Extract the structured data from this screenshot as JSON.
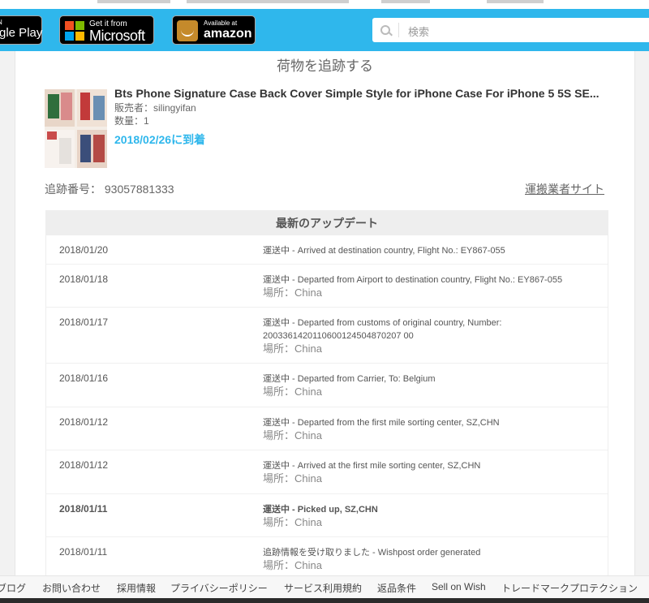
{
  "header": {
    "google_play": {
      "small": "N",
      "big": "gle Play"
    },
    "microsoft": {
      "small": "Get it from",
      "big": "Microsoft"
    },
    "amazon": {
      "small": "Available at",
      "big": "amazon",
      "brand_text": "amazon"
    },
    "search_placeholder": "検索"
  },
  "page": {
    "title": "荷物を追跡する",
    "product_name": "Bts Phone Signature Case Back Cover Simple Style for iPhone Case For iPhone 5 5S SE...",
    "seller": "販売者：silingyifan",
    "quantity": "数量：1",
    "arrival": "2018/02/26に到着",
    "tracking_number": "追跡番号： 93057881333",
    "carrier_site_link": "運搬業者サイト",
    "updates_title": "最新のアップデート"
  },
  "updates": [
    {
      "date": "2018/01/20",
      "status": "運送中 - Arrived at destination country, Flight No.: EY867-055",
      "location": ""
    },
    {
      "date": "2018/01/18",
      "status": "運送中 - Departed from Airport to destination country, Flight No.: EY867-055",
      "location": "場所：China"
    },
    {
      "date": "2018/01/17",
      "status": "運送中 - Departed from customs of original country, Number: 2003361420110600124504870207 00",
      "location": "場所：China"
    },
    {
      "date": "2018/01/16",
      "status": "運送中 - Departed from Carrier, To: Belgium",
      "location": "場所：China"
    },
    {
      "date": "2018/01/12",
      "status": "運送中 - Departed from the first mile sorting center, SZ,CHN",
      "location": "場所：China"
    },
    {
      "date": "2018/01/12",
      "status": "運送中 - Arrived at the first mile sorting center, SZ,CHN",
      "location": "場所：China"
    },
    {
      "date": "2018/01/11",
      "status": "運送中 - Picked up, SZ,CHN",
      "location": "場所：China"
    },
    {
      "date": "2018/01/11",
      "status": "追跡情報を受け取りました - Wishpost order generated",
      "location": "場所：China"
    }
  ],
  "footer": [
    "ブログ",
    "お問い合わせ",
    "採用情報",
    "プライバシーポリシー",
    "サービス利用規約",
    "返品条件",
    "Sell on Wish",
    "トレードマークプロテクション"
  ],
  "colors": {
    "header": "#2fb7ec",
    "accent": "#2fb7ec"
  }
}
